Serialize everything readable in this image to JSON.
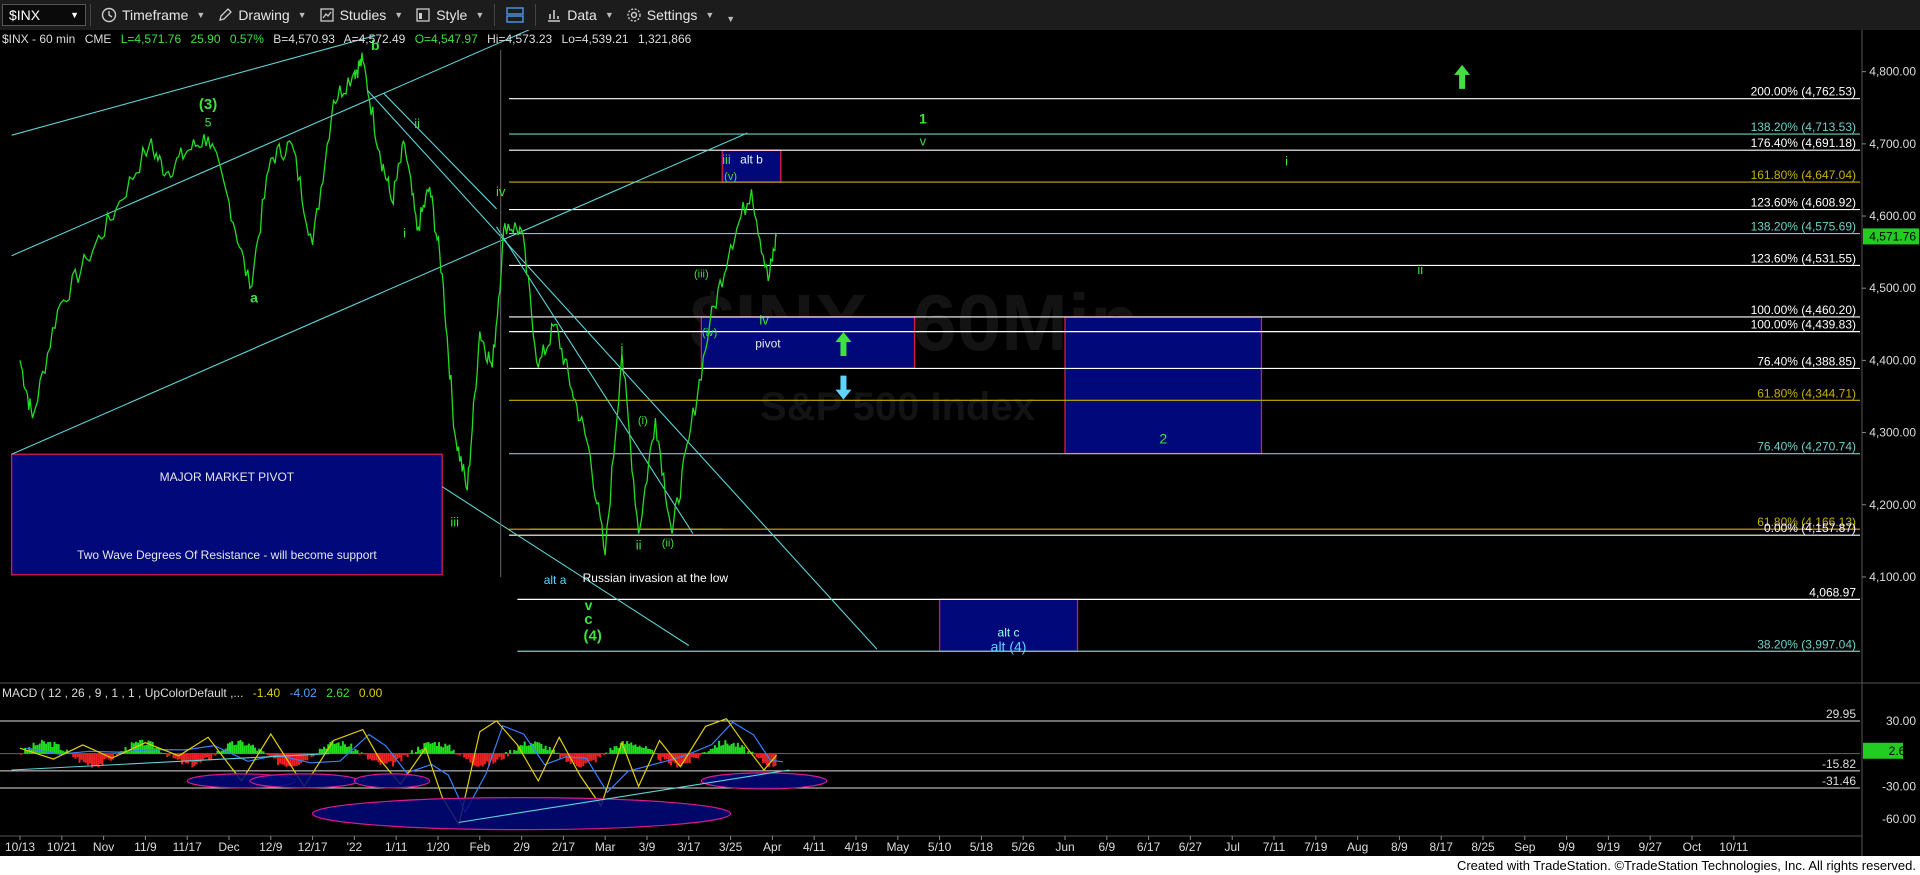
{
  "toolbar": {
    "symbol": "$INX",
    "timeframe": "Timeframe",
    "drawing": "Drawing",
    "studies": "Studies",
    "style": "Style",
    "data": "Data",
    "settings": "Settings"
  },
  "header": {
    "symbol": "$INX - 60 min",
    "exchange": "CME",
    "last": "L=4,571.76",
    "change": "25.90",
    "pct": "0.57%",
    "bid": "B=4,570.93",
    "ask": "A=4,572.49",
    "open": "O=4,547.97",
    "high": "Hi=4,573.23",
    "low": "Lo=4,539.21",
    "volume": "1,321,866"
  },
  "macd_header": {
    "label": "MACD ( 12 , 26 , 9 , 1 , 1 , UpColorDefault ,...",
    "v1": "-1.40",
    "v2": "-4.02",
    "v3": "2.62",
    "v4": "0.00"
  },
  "footer": "Created with TradeStation. ©TradeStation Technologies, Inc. All rights reserved.",
  "colors": {
    "background": "#000000",
    "price": "#22dd22",
    "trendline": "#5fd3d8",
    "zone_fill": "#00087a",
    "zone_border": "#d81b4a",
    "fib_gold": "#c9b000",
    "fib_teal": "#6fd0c7",
    "fib_white": "#ffffff",
    "wave_green": "#3fe03f",
    "wave_cyan": "#5fd3ff"
  },
  "chart_data": {
    "type": "line",
    "title": "",
    "ylim": [
      3960,
      4830
    ],
    "price_ticks": [
      {
        "label": "4,800.00",
        "v": 4800
      },
      {
        "label": "4,700.00",
        "v": 4700
      },
      {
        "label": "4,600.00",
        "v": 4600
      },
      {
        "label": "4,500.00",
        "v": 4500
      },
      {
        "label": "4,400.00",
        "v": 4400
      },
      {
        "label": "4,300.00",
        "v": 4300
      },
      {
        "label": "4,200.00",
        "v": 4200
      },
      {
        "label": "4,100.00",
        "v": 4100
      }
    ],
    "last_price": "4,571.76",
    "x_ticks": [
      "10/13",
      "10/21",
      "Nov",
      "11/9",
      "11/17",
      "Dec",
      "12/9",
      "12/17",
      "'22",
      "1/11",
      "1/20",
      "Feb",
      "2/9",
      "2/17",
      "Mar",
      "3/9",
      "3/17",
      "3/25",
      "Apr",
      "4/11",
      "4/19",
      "May",
      "5/10",
      "5/18",
      "5/26",
      "Jun",
      "6/9",
      "6/17",
      "6/27",
      "Jul",
      "7/11",
      "7/19",
      "Aug",
      "8/9",
      "8/17",
      "8/25",
      "Sep",
      "9/9",
      "9/19",
      "9/27",
      "Oct",
      "10/11"
    ],
    "x_tick_indices": [
      0,
      1,
      2,
      3,
      4,
      5,
      6,
      7,
      8,
      9,
      10,
      11,
      12,
      13,
      14,
      15,
      16,
      17,
      18,
      19,
      20,
      21,
      22,
      23,
      24,
      25,
      26,
      27,
      28,
      29,
      30,
      31,
      32,
      33,
      34,
      35,
      36,
      37,
      38,
      39,
      40,
      41
    ],
    "data_end_index": 18.1,
    "pivots": [
      {
        "t": 0.0,
        "p": 4400
      },
      {
        "t": 0.3,
        "p": 4320
      },
      {
        "t": 0.9,
        "p": 4470
      },
      {
        "t": 1.6,
        "p": 4540
      },
      {
        "t": 2.3,
        "p": 4610
      },
      {
        "t": 3.1,
        "p": 4700
      },
      {
        "t": 3.5,
        "p": 4660
      },
      {
        "t": 4.0,
        "p": 4690
      },
      {
        "t": 4.5,
        "p": 4710
      },
      {
        "t": 5.0,
        "p": 4620
      },
      {
        "t": 5.5,
        "p": 4500
      },
      {
        "t": 6.0,
        "p": 4680
      },
      {
        "t": 6.5,
        "p": 4700
      },
      {
        "t": 7.0,
        "p": 4560
      },
      {
        "t": 7.5,
        "p": 4760
      },
      {
        "t": 8.0,
        "p": 4800
      },
      {
        "t": 8.2,
        "p": 4815
      },
      {
        "t": 8.6,
        "p": 4690
      },
      {
        "t": 8.9,
        "p": 4620
      },
      {
        "t": 9.2,
        "p": 4700
      },
      {
        "t": 9.5,
        "p": 4580
      },
      {
        "t": 9.8,
        "p": 4640
      },
      {
        "t": 10.1,
        "p": 4520
      },
      {
        "t": 10.4,
        "p": 4300
      },
      {
        "t": 10.7,
        "p": 4220
      },
      {
        "t": 11.0,
        "p": 4440
      },
      {
        "t": 11.3,
        "p": 4390
      },
      {
        "t": 11.6,
        "p": 4590
      },
      {
        "t": 12.0,
        "p": 4580
      },
      {
        "t": 12.4,
        "p": 4390
      },
      {
        "t": 12.8,
        "p": 4450
      },
      {
        "t": 13.2,
        "p": 4360
      },
      {
        "t": 13.6,
        "p": 4280
      },
      {
        "t": 14.0,
        "p": 4130
      },
      {
        "t": 14.4,
        "p": 4410
      },
      {
        "t": 14.8,
        "p": 4160
      },
      {
        "t": 15.2,
        "p": 4320
      },
      {
        "t": 15.6,
        "p": 4160
      },
      {
        "t": 16.0,
        "p": 4290
      },
      {
        "t": 16.5,
        "p": 4450
      },
      {
        "t": 17.0,
        "p": 4560
      },
      {
        "t": 17.5,
        "p": 4637
      },
      {
        "t": 17.9,
        "p": 4510
      },
      {
        "t": 18.1,
        "p": 4572
      }
    ],
    "fib_lines": [
      {
        "label": "200.00% (4,762.53)",
        "v": 4762.53,
        "color": "white"
      },
      {
        "label": "138.20% (4,713.53)",
        "v": 4713.53,
        "color": "teal"
      },
      {
        "label": "176.40% (4,691.18)",
        "v": 4691.18,
        "color": "white"
      },
      {
        "label": "161.80% (4,647.04)",
        "v": 4647.04,
        "color": "gold"
      },
      {
        "label": "123.60% (4,608.92)",
        "v": 4608.92,
        "color": "white"
      },
      {
        "label": "138.20% (4,575.69)",
        "v": 4575.69,
        "color": "teal"
      },
      {
        "label": "123.60% (4,531.55)",
        "v": 4531.55,
        "color": "white"
      },
      {
        "label": "100.00% (4,460.20)",
        "v": 4460.2,
        "color": "white"
      },
      {
        "label": "100.00% (4,439.83)",
        "v": 4439.83,
        "color": "white"
      },
      {
        "label": "76.40% (4,388.85)",
        "v": 4388.85,
        "color": "white"
      },
      {
        "label": "61.80% (4,344.71)",
        "v": 4344.71,
        "color": "gold"
      },
      {
        "label": "76.40% (4,270.74)",
        "v": 4270.74,
        "color": "teal"
      },
      {
        "label": "61.80% (4,166.13)",
        "v": 4166.13,
        "color": "gold"
      },
      {
        "label": "0.00% (4,157.87)",
        "v": 4157.87,
        "color": "white"
      },
      {
        "label": "4,068.97",
        "v": 4068.97,
        "color": "white"
      },
      {
        "label": "38.20% (3,997.04)",
        "v": 3997.04,
        "color": "teal"
      }
    ],
    "zones": [
      {
        "name": "major-market-pivot",
        "t0": -0.2,
        "t1": 10.1,
        "p_top": 4270,
        "p_bot": 4103,
        "labels": [
          "MAJOR MARKET PIVOT",
          "Two Wave Degrees Of Resistance - will become support"
        ]
      },
      {
        "name": "pivot",
        "t0": 16.3,
        "t1": 21.4,
        "p_top": 4460,
        "p_bot": 4389,
        "labels": [
          "pivot"
        ]
      },
      {
        "name": "wave-2",
        "t0": 25.0,
        "t1": 29.7,
        "p_top": 4460,
        "p_bot": 4271,
        "labels": [
          "2"
        ]
      },
      {
        "name": "alt-b",
        "t0": 16.8,
        "t1": 18.2,
        "p_top": 4691,
        "p_bot": 4647,
        "labels": [
          "alt b"
        ]
      },
      {
        "name": "alt-c",
        "t0": 22.0,
        "t1": 25.3,
        "p_top": 4069,
        "p_bot": 3997,
        "labels": [
          "alt c",
          "alt (4)"
        ]
      }
    ],
    "annotations": [
      {
        "text": "(3)",
        "t": 4.5,
        "p": 4748,
        "c": "green",
        "s": 15
      },
      {
        "text": "5",
        "t": 4.5,
        "p": 4724,
        "c": "green",
        "s": 12
      },
      {
        "text": "b",
        "t": 8.5,
        "p": 4830,
        "c": "green",
        "s": 14
      },
      {
        "text": "ii",
        "t": 9.5,
        "p": 4722,
        "c": "green",
        "s": 13
      },
      {
        "text": "a",
        "t": 5.6,
        "p": 4480,
        "c": "green",
        "s": 14
      },
      {
        "text": "iv",
        "t": 11.5,
        "p": 4628,
        "c": "green",
        "s": 13
      },
      {
        "text": "i",
        "t": 9.2,
        "p": 4570,
        "c": "green",
        "s": 13
      },
      {
        "text": "iii",
        "t": 10.4,
        "p": 4170,
        "c": "green",
        "s": 13
      },
      {
        "text": "alt a",
        "t": 12.8,
        "p": 4090,
        "c": "cyan",
        "s": 12
      },
      {
        "text": "Russian invasion at the low",
        "t": 15.2,
        "p": 4093,
        "c": "white",
        "s": 12
      },
      {
        "text": "v",
        "t": 13.6,
        "p": 4054,
        "c": "green",
        "s": 14
      },
      {
        "text": "c",
        "t": 13.6,
        "p": 4035,
        "c": "green",
        "s": 15
      },
      {
        "text": "(4)",
        "t": 13.7,
        "p": 4012,
        "c": "green",
        "s": 15
      },
      {
        "text": "i",
        "t": 14.4,
        "p": 4410,
        "c": "green",
        "s": 13
      },
      {
        "text": "ii",
        "t": 14.8,
        "p": 4138,
        "c": "green",
        "s": 13
      },
      {
        "text": "(ii)",
        "t": 15.5,
        "p": 4142,
        "c": "green",
        "s": 11
      },
      {
        "text": "(i)",
        "t": 14.9,
        "p": 4312,
        "c": "green",
        "s": 11
      },
      {
        "text": "(iii)",
        "t": 16.3,
        "p": 4515,
        "c": "green",
        "s": 11
      },
      {
        "text": "(iv)",
        "t": 16.5,
        "p": 4434,
        "c": "green",
        "s": 11
      },
      {
        "text": "iii",
        "t": 16.9,
        "p": 4672,
        "c": "green",
        "s": 13
      },
      {
        "text": "(v)",
        "t": 17.0,
        "p": 4650,
        "c": "green",
        "s": 11
      },
      {
        "text": "iv",
        "t": 17.8,
        "p": 4450,
        "c": "green",
        "s": 13
      },
      {
        "text": "1",
        "t": 21.6,
        "p": 4728,
        "c": "green",
        "s": 14
      },
      {
        "text": "v",
        "t": 21.6,
        "p": 4698,
        "c": "green",
        "s": 13
      },
      {
        "text": "i",
        "t": 30.3,
        "p": 4670,
        "c": "green",
        "s": 13
      },
      {
        "text": "ii",
        "t": 33.5,
        "p": 4520,
        "c": "green",
        "s": 13
      }
    ],
    "arrows": [
      {
        "name": "target-up-arrow",
        "t": 34.5,
        "p": 4790,
        "dir": "up",
        "c": "green"
      },
      {
        "name": "pivot-up-arrow",
        "t": 19.7,
        "p": 4420,
        "dir": "up",
        "c": "green"
      },
      {
        "name": "pivot-down-arrow",
        "t": 19.7,
        "p": 4365,
        "dir": "down",
        "c": "cyan"
      }
    ],
    "macd": {
      "ylim": [
        -70,
        40
      ],
      "ticks": [
        {
          "label": "30.00",
          "v": 30
        },
        {
          "label": "-30.00",
          "v": -30
        },
        {
          "label": "-60.00",
          "v": -60
        }
      ],
      "levels": [
        {
          "label": "29.95",
          "v": 29.95
        },
        {
          "label": "-15.82",
          "v": -15.82
        },
        {
          "label": "-31.46",
          "v": -31.46
        }
      ],
      "last": "2.62",
      "pivots": [
        {
          "t": 0.0,
          "v": 5
        },
        {
          "t": 0.8,
          "v": -5
        },
        {
          "t": 1.5,
          "v": 8
        },
        {
          "t": 2.2,
          "v": -4
        },
        {
          "t": 3.0,
          "v": 10
        },
        {
          "t": 3.8,
          "v": -2
        },
        {
          "t": 4.5,
          "v": 15
        },
        {
          "t": 5.3,
          "v": -25
        },
        {
          "t": 6.0,
          "v": 18
        },
        {
          "t": 6.8,
          "v": -30
        },
        {
          "t": 7.5,
          "v": 12
        },
        {
          "t": 8.2,
          "v": 22
        },
        {
          "t": 8.6,
          "v": -5
        },
        {
          "t": 9.1,
          "v": -28
        },
        {
          "t": 9.7,
          "v": 5
        },
        {
          "t": 10.1,
          "v": -40
        },
        {
          "t": 10.5,
          "v": -65
        },
        {
          "t": 11.0,
          "v": 20
        },
        {
          "t": 11.4,
          "v": 30
        },
        {
          "t": 11.9,
          "v": 8
        },
        {
          "t": 12.4,
          "v": -25
        },
        {
          "t": 12.9,
          "v": 15
        },
        {
          "t": 13.4,
          "v": -20
        },
        {
          "t": 13.9,
          "v": -48
        },
        {
          "t": 14.4,
          "v": 10
        },
        {
          "t": 14.8,
          "v": -30
        },
        {
          "t": 15.3,
          "v": 12
        },
        {
          "t": 15.8,
          "v": -12
        },
        {
          "t": 16.4,
          "v": 25
        },
        {
          "t": 16.9,
          "v": 32
        },
        {
          "t": 17.4,
          "v": 5
        },
        {
          "t": 17.8,
          "v": -15
        },
        {
          "t": 18.1,
          "v": -1.4
        }
      ]
    }
  }
}
